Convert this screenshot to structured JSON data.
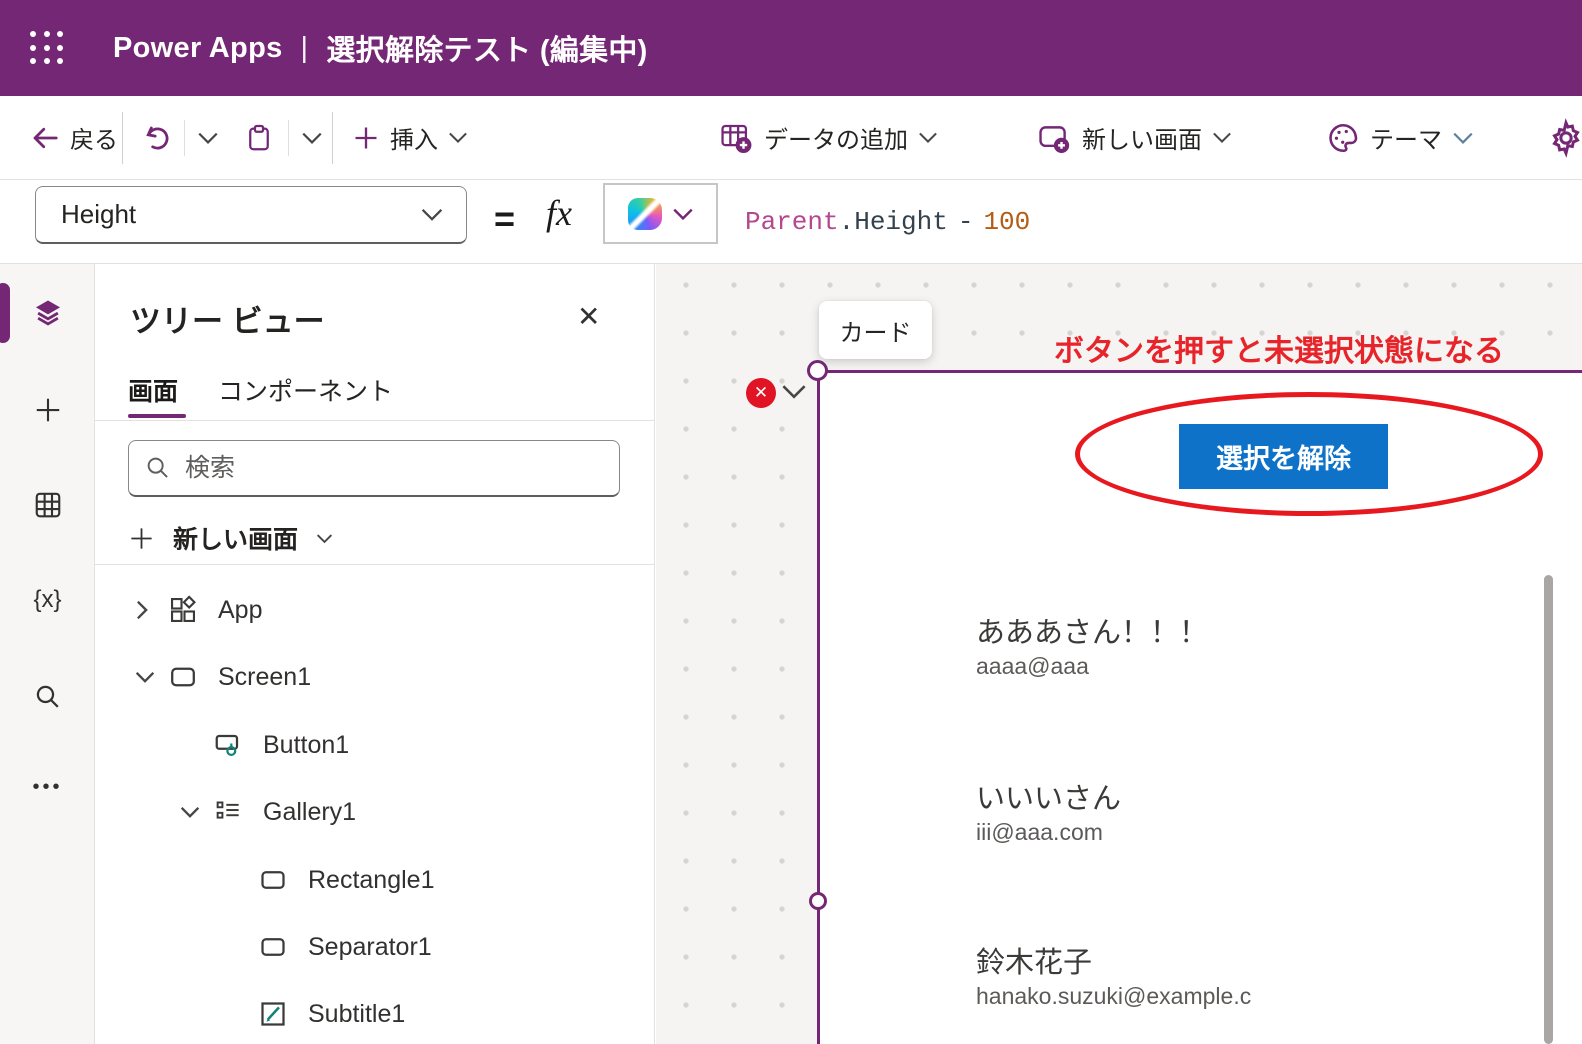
{
  "header": {
    "brand": "Power Apps",
    "divider": "|",
    "app_title": "選択解除テスト (編集中)"
  },
  "toolbar": {
    "back_label": "戻る",
    "insert_label": "挿入",
    "add_data_label": "データの追加",
    "new_screen_label": "新しい画面",
    "theme_label": "テーマ"
  },
  "formula_bar": {
    "property_selected": "Height",
    "equals": "=",
    "fx": "fx",
    "code": {
      "object": "Parent",
      "member": ".Height",
      "operator": "-",
      "number": "100"
    }
  },
  "rail": {
    "items": [
      "tree-view",
      "insert",
      "data",
      "variables",
      "search",
      "more"
    ]
  },
  "tree_panel": {
    "title": "ツリー ビュー",
    "tabs": [
      {
        "label": "画面",
        "active": true
      },
      {
        "label": "コンポーネント",
        "active": false
      }
    ],
    "search_placeholder": "検索",
    "new_screen_label": "新しい画面",
    "items": [
      {
        "label": "App",
        "icon": "app",
        "chevron": "right",
        "level": 1
      },
      {
        "label": "Screen1",
        "icon": "screen",
        "chevron": "down",
        "level": 1
      },
      {
        "label": "Button1",
        "icon": "button",
        "chevron": null,
        "level": 2
      },
      {
        "label": "Gallery1",
        "icon": "gallery",
        "chevron": "down",
        "level": 2
      },
      {
        "label": "Rectangle1",
        "icon": "rectangle",
        "chevron": null,
        "level": 3
      },
      {
        "label": "Separator1",
        "icon": "rectangle",
        "chevron": null,
        "level": 3
      },
      {
        "label": "Subtitle1",
        "icon": "pencil",
        "chevron": null,
        "level": 3
      }
    ]
  },
  "canvas": {
    "selection_tooltip": "カード",
    "annotation": "ボタンを押すと未選択状態になる",
    "deselect_button_label": "選択を解除",
    "gallery": [
      {
        "name": "あああさん！！！",
        "email": "aaaa@aaa"
      },
      {
        "name": "いいいさん",
        "email": "iii@aaa.com"
      },
      {
        "name": "鈴木花子",
        "email": "hanako.suzuki@example.c"
      }
    ]
  },
  "glyphs": {
    "close": "✕",
    "badge_x": "✕",
    "braces": "{x}",
    "more_dots": "•••",
    "plus": "+"
  },
  "colors": {
    "brand_purple": "#742774",
    "button_blue": "#0e72c8",
    "annotation_red": "#e8242b",
    "badge_red": "#e11426",
    "formula_object": "#b4478f",
    "formula_number": "#b35c12",
    "teal_accent": "#12827c"
  }
}
